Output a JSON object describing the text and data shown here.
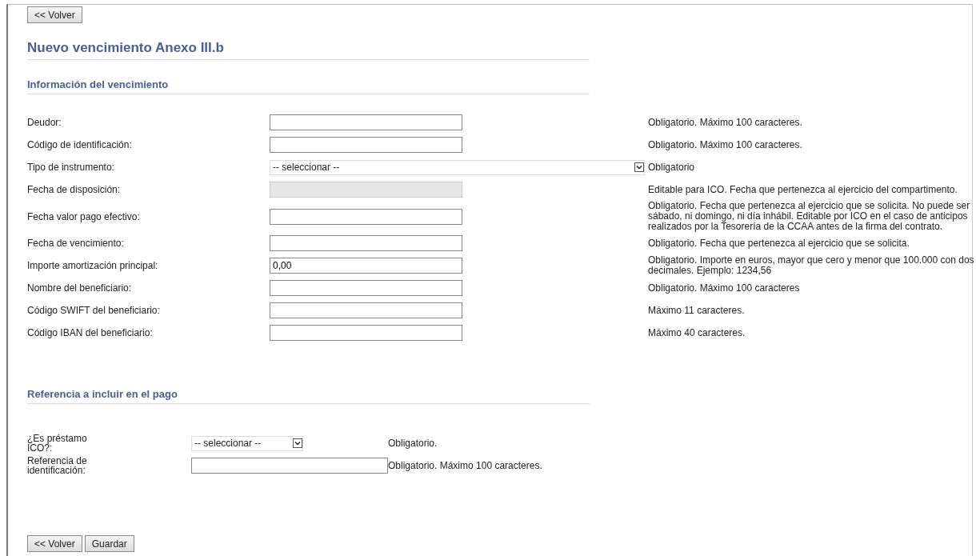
{
  "top_button": "<< Volver",
  "title": "Nuevo vencimiento Anexo III.b",
  "section_1": {
    "heading": "Información del vencimiento",
    "fields": [
      {
        "label": "Deudor:",
        "kind": "text",
        "help": "Obligatorio. Máximo 100 caracteres."
      },
      {
        "label": "Código de identificación:",
        "kind": "text",
        "help": "Obligatorio. Máximo 100 caracteres."
      },
      {
        "label": "Tipo de instrumento:",
        "kind": "select",
        "value": "-- seleccionar --",
        "help": "Obligatorio"
      },
      {
        "label": "Fecha de disposición:",
        "kind": "disabled",
        "help": "Editable para ICO. Fecha que pertenezca al ejercicio del compartimento."
      },
      {
        "label": "Fecha valor pago efectivo:",
        "kind": "text",
        "help": "Obligatorio. Fecha que pertenezca al ejercicio que se solicita. No puede ser sábado, ni domingo, ni día inhábil. Editable por ICO en el caso de anticipos realizados por la Tesorería de la CCAA antes de la firma del contrato."
      },
      {
        "label": "Fecha de vencimiento:",
        "kind": "text",
        "help": "Obligatorio. Fecha que pertenezca al ejercicio que se solicita."
      },
      {
        "label": "Importe amortización principal:",
        "kind": "text",
        "value": "0,00",
        "help": "Obligatorio. Importe en euros, mayor que cero y menor que 100.000 con dos decimales. Ejemplo: 1234,56"
      },
      {
        "label": "Nombre del beneficiario:",
        "kind": "text",
        "help": "Obligatorio. Máximo 100 caracteres"
      },
      {
        "label": "Código SWIFT del beneficiario:",
        "kind": "text",
        "help": "Máximo 11 caracteres."
      },
      {
        "label": "Código IBAN del beneficiario:",
        "kind": "text",
        "help": "Máximo 40 caracteres."
      }
    ]
  },
  "section_2": {
    "heading": "Referencia a incluir en el pago",
    "fields": [
      {
        "label": "¿Es préstamo ICO?:",
        "kind": "select",
        "value": "-- seleccionar --",
        "help": "Obligatorio."
      },
      {
        "label": "Referencia de identificación:",
        "kind": "text",
        "help": "Obligatorio. Máximo 100 caracteres."
      }
    ]
  },
  "bottom_buttons": [
    "<< Volver",
    "Guardar"
  ]
}
